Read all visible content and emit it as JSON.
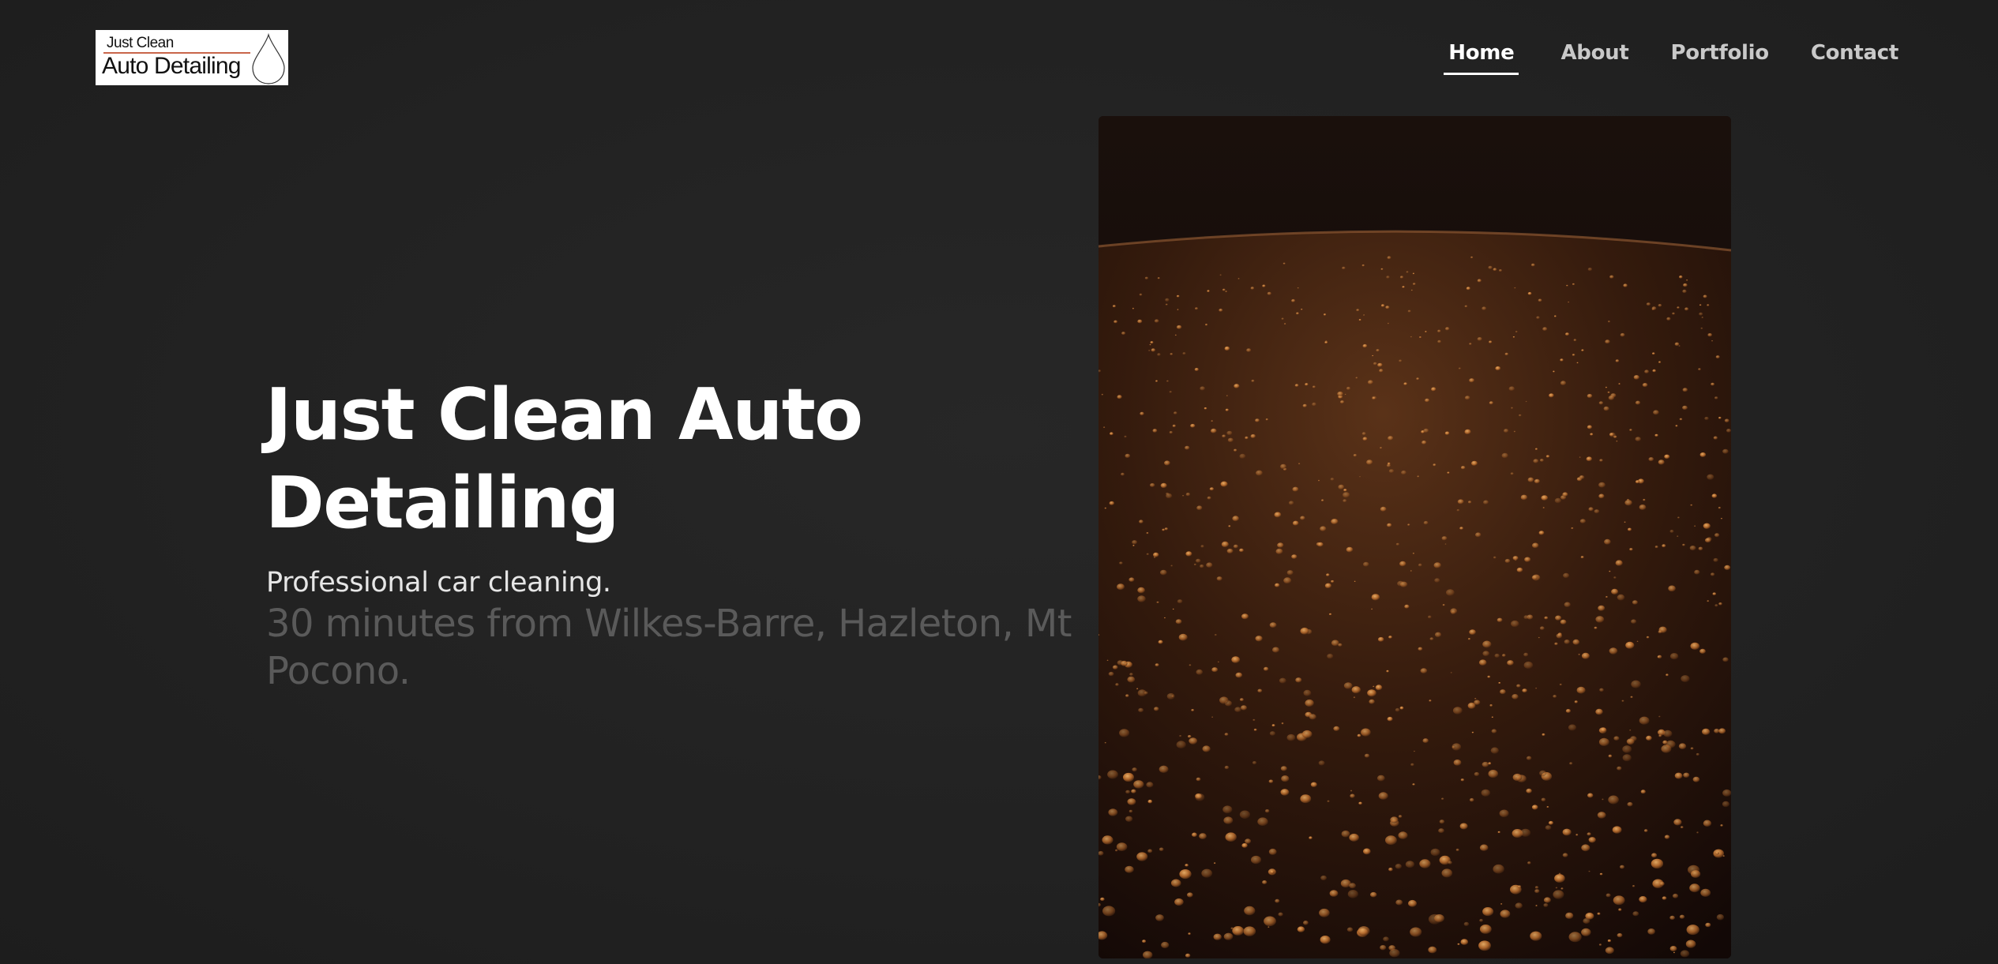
{
  "header": {
    "logo": {
      "line1": "Just Clean",
      "line2": "Auto Detailing",
      "icon": "water-drop-icon",
      "accent_color": "#c8654a"
    },
    "nav": [
      {
        "label": "Home",
        "active": true
      },
      {
        "label": "About",
        "active": false
      },
      {
        "label": "Portfolio",
        "active": false
      },
      {
        "label": "Contact",
        "active": false
      }
    ]
  },
  "hero": {
    "title": "Just Clean Auto Detailing",
    "subtitle": "Professional car cleaning.",
    "location": "30 minutes from Wilkes-Barre, Hazleton, Mt Pocono.",
    "image": "water-droplets-on-car-photo"
  },
  "colors": {
    "background": "#232323",
    "text_primary": "#ffffff",
    "text_muted": "#5a5a5a",
    "nav_inactive": "#c9c9c9",
    "photo_tone": "#c87a3a"
  }
}
